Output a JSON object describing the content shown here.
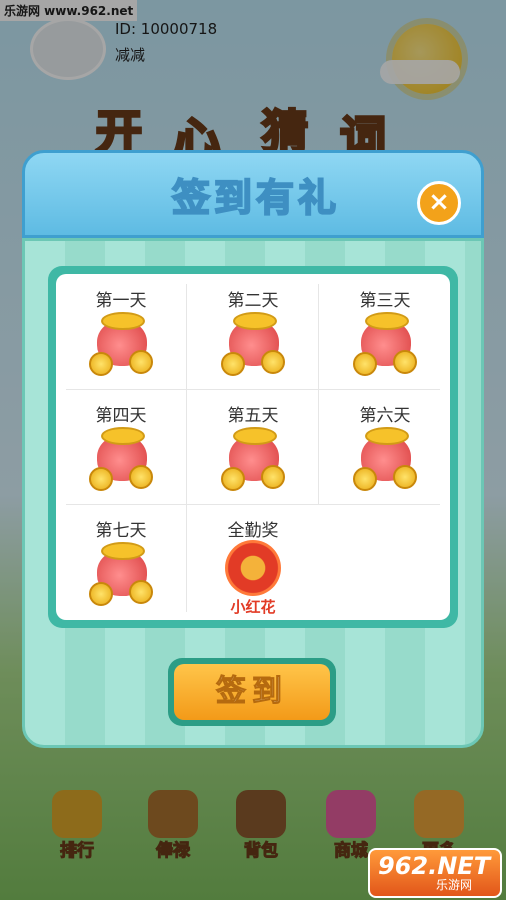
{
  "watermark": "乐游网 www.962.net",
  "user": {
    "id_text": "ID: 10000718",
    "name": "减减"
  },
  "logo_text": [
    "开",
    "心",
    "猜",
    "词"
  ],
  "dialog": {
    "title": "签到有礼",
    "close_icon": "close-icon",
    "days": [
      {
        "label": "第一天",
        "reward_icon": "coin-bag-icon"
      },
      {
        "label": "第二天",
        "reward_icon": "coin-bag-icon"
      },
      {
        "label": "第三天",
        "reward_icon": "coin-bag-icon"
      },
      {
        "label": "第四天",
        "reward_icon": "coin-bag-icon"
      },
      {
        "label": "第五天",
        "reward_icon": "coin-bag-icon"
      },
      {
        "label": "第六天",
        "reward_icon": "coin-bag-icon"
      },
      {
        "label": "第七天",
        "reward_icon": "coin-bag-icon"
      }
    ],
    "full_attendance": {
      "label": "全勤奖",
      "reward_label": "小红花",
      "reward_icon": "red-flower-icon"
    },
    "sign_button": "签到"
  },
  "nav": {
    "items": [
      {
        "label": "排行",
        "icon": "trophy-icon"
      },
      {
        "label": "俸禄",
        "icon": "treasure-chest-icon"
      },
      {
        "label": "背包",
        "icon": "backpack-icon"
      },
      {
        "label": "商城",
        "icon": "gift-box-icon"
      },
      {
        "label": "更多",
        "icon": "plus-icon"
      }
    ]
  },
  "brand": {
    "text": "962.NET",
    "sub": "乐游网"
  },
  "colors": {
    "accent": "#f3a21a",
    "header": "#5ebbe3",
    "panel": "#a7e4d7",
    "frame": "#3fb8a5"
  }
}
